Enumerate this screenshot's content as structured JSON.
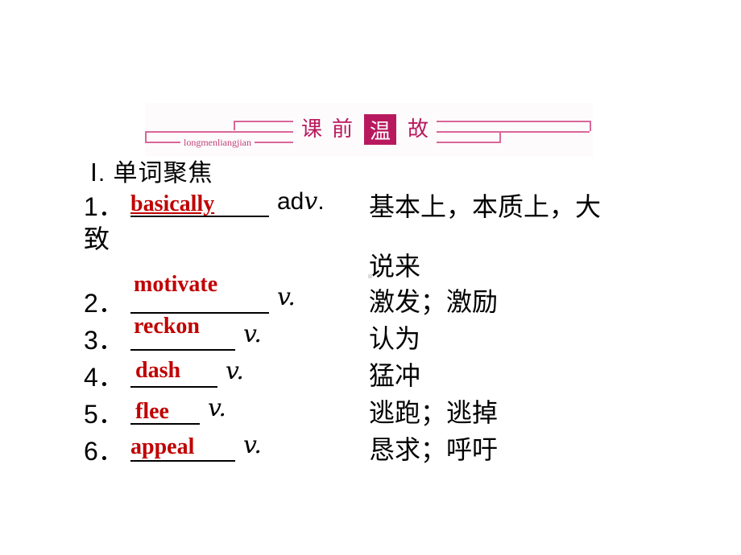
{
  "banner": {
    "title_chars": [
      "课",
      "前",
      "温",
      "故"
    ],
    "highlighted_char": "温",
    "subtitle": "longmenliangjian",
    "accent_color": "#b8195e",
    "line_color": "#d9669a"
  },
  "section": {
    "title": "Ⅰ. 单词聚焦"
  },
  "answer_color": "#c00000",
  "items": [
    {
      "number": "1．",
      "answer": "basically",
      "pos": "adv.",
      "meaning_line1": "基本上，本质上，大",
      "wrap": "致",
      "meaning_line2": "说来"
    },
    {
      "number": "2．",
      "answer": "motivate",
      "pos": "v.",
      "meaning": "激发；激励"
    },
    {
      "number": "3．",
      "answer": "reckon",
      "pos": "v.",
      "meaning": "认为"
    },
    {
      "number": "4．",
      "answer": "dash",
      "pos": "v.",
      "meaning": "猛冲"
    },
    {
      "number": "5．",
      "answer": "flee",
      "pos": "v.",
      "meaning": "逃跑；逃掉"
    },
    {
      "number": "6．",
      "answer": "appeal",
      "pos": "v.",
      "meaning": "恳求；呼吁"
    }
  ]
}
